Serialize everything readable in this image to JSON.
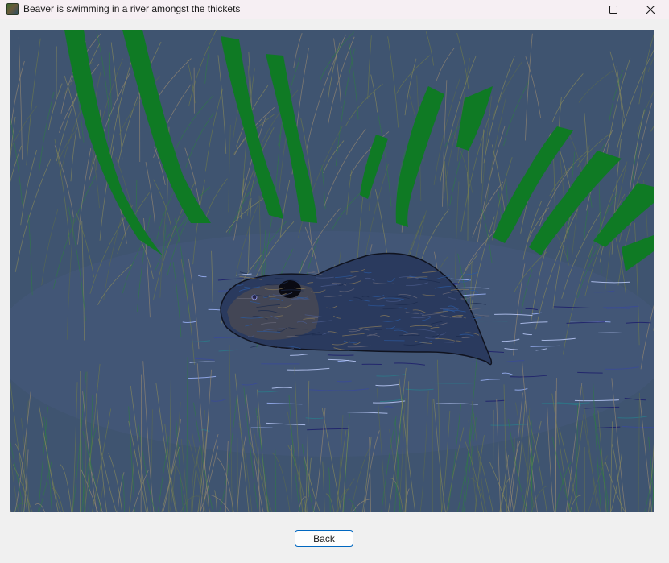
{
  "window": {
    "title": "Beaver is swimming in a river amongst the thickets",
    "icon": "beaver-picture-icon",
    "controls": [
      "minimize-icon",
      "maximize-icon",
      "close-icon"
    ]
  },
  "picture": {
    "subject": "beaver-swimming-drawing",
    "colors": {
      "water": "#3f5470",
      "reeds": "#0d7a25",
      "grass": "#8a8a5a",
      "beaver": "#2c3a5c",
      "ripples": "#a0b8ff"
    }
  },
  "footer": {
    "back_label": "Back"
  }
}
